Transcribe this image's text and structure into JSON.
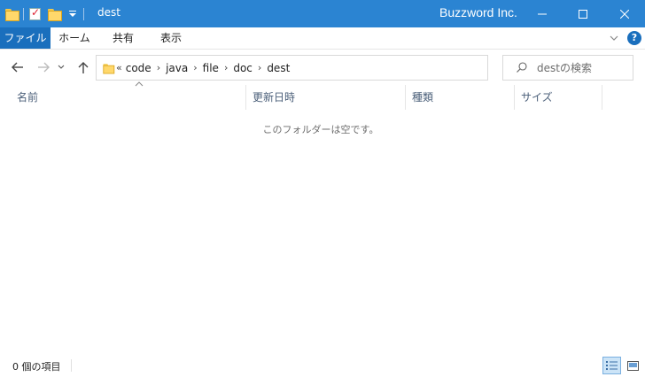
{
  "titlebar": {
    "folder_title": "dest",
    "app_name": "Buzzword Inc."
  },
  "ribbon": {
    "tabs": [
      {
        "label": "ファイル"
      },
      {
        "label": "ホーム"
      },
      {
        "label": "共有"
      },
      {
        "label": "表示"
      }
    ],
    "help_label": "?"
  },
  "address": {
    "overflow": "«",
    "path": [
      "code",
      "java",
      "file",
      "doc",
      "dest"
    ]
  },
  "search": {
    "placeholder": "destの検索"
  },
  "columns": {
    "name": "名前",
    "date": "更新日時",
    "type": "種類",
    "size": "サイズ"
  },
  "content": {
    "empty_message": "このフォルダーは空です。"
  },
  "status": {
    "item_count": "0 個の項目"
  },
  "colors": {
    "titlebar": "#2b84d2",
    "file_tab": "#1a6fbd",
    "column_text": "#4c607a"
  }
}
